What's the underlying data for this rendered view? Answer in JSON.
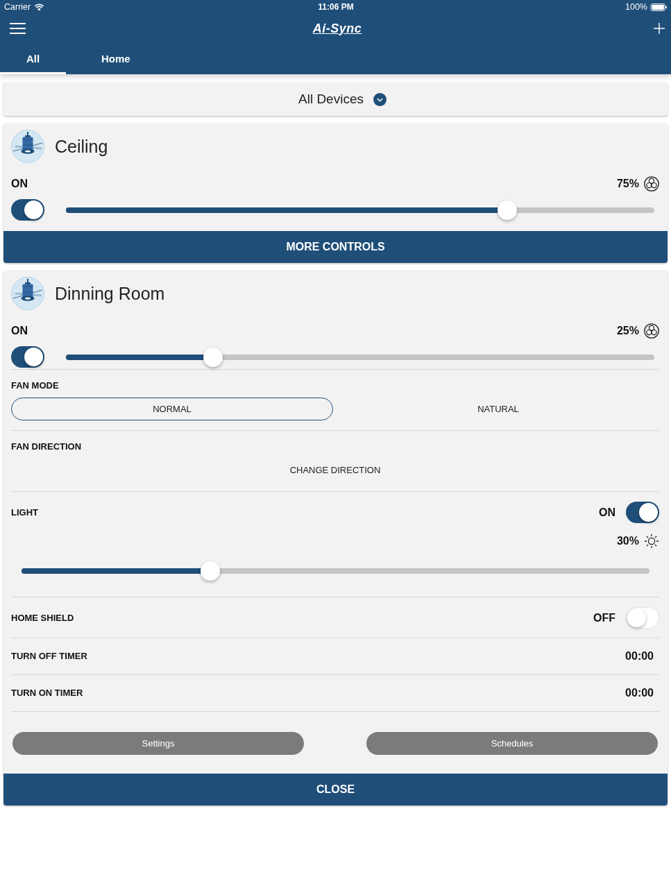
{
  "status_bar": {
    "carrier": "Carrier",
    "time": "11:06 PM",
    "battery": "100%"
  },
  "header": {
    "logo": "Ai-Sync"
  },
  "tabs": [
    {
      "label": "All",
      "selected": true
    },
    {
      "label": "Home",
      "selected": false
    }
  ],
  "device_filter": {
    "label": "All Devices"
  },
  "devices": [
    {
      "name": "Ceiling",
      "power_label": "ON",
      "on": true,
      "speed": "75%",
      "level": 0.75,
      "button": "MORE CONTROLS"
    },
    {
      "name": "Dinning Room",
      "power_label": "ON",
      "on": true,
      "speed": "25%",
      "level": 0.25,
      "details": {
        "fan_mode": {
          "label": "FAN MODE",
          "options": [
            {
              "label": "NORMAL",
              "selected": true
            },
            {
              "label": "NATURAL",
              "selected": false
            }
          ]
        },
        "fan_direction": {
          "label": "FAN DIRECTION",
          "button": "CHANGE DIRECTION"
        },
        "light": {
          "label": "LIGHT",
          "state_label": "ON",
          "on": true,
          "brightness": "30%",
          "level": 0.3
        },
        "home_shield": {
          "label": "HOME SHIELD",
          "state_label": "OFF",
          "on": false
        },
        "timers": [
          {
            "label": "TURN OFF TIMER",
            "value": "00:00"
          },
          {
            "label": "TURN ON TIMER",
            "value": "00:00"
          }
        ],
        "buttons": [
          "Settings",
          "Schedules"
        ]
      },
      "button": "CLOSE"
    }
  ]
}
